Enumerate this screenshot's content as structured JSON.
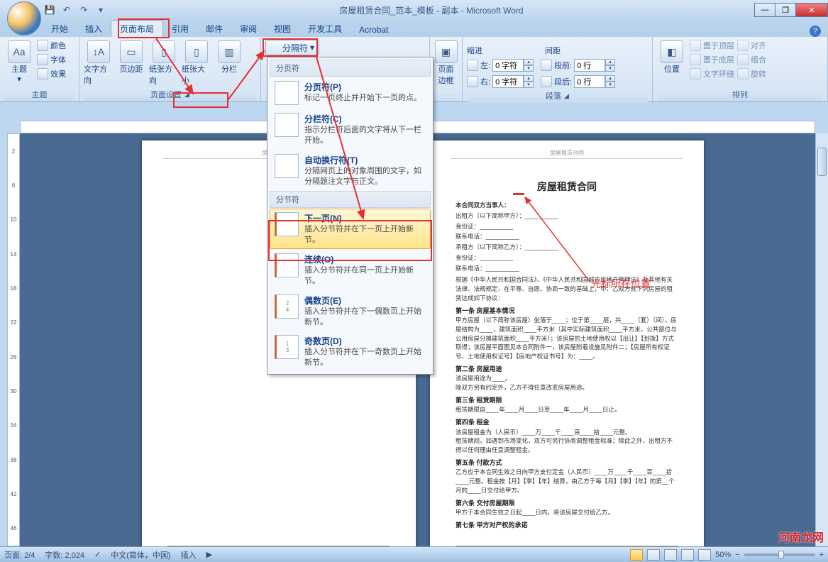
{
  "title": "房屋租赁合同_范本_模板 - 副本 - Microsoft Word",
  "tabs": [
    "开始",
    "插入",
    "页面布局",
    "引用",
    "邮件",
    "审阅",
    "视图",
    "开发工具",
    "Acrobat"
  ],
  "active_tab": "页面布局",
  "ribbon": {
    "theme": {
      "label": "主题",
      "colors": "颜色",
      "fonts": "字体",
      "effects": "效果",
      "main": "主题"
    },
    "page_setup": {
      "label": "页面设置",
      "text_dir": "文字方向",
      "margins": "页边距",
      "orient": "纸张方向",
      "size": "纸张大小",
      "columns": "分栏",
      "breaks": "分隔符"
    },
    "page_bg": {
      "label": "页面边框",
      "btn": "页面\n边框"
    },
    "indent": {
      "group": "缩进",
      "left": "左:",
      "right": "右:",
      "val": "0 字符"
    },
    "spacing": {
      "group": "间距",
      "before": "段前:",
      "after": "段后:",
      "val": "0 行"
    },
    "para": "段落",
    "arrange": {
      "label": "排列",
      "pos": "位置",
      "top": "置于顶层",
      "bottom": "置于底层",
      "wrap": "文字环绕",
      "align": "对齐",
      "group": "组合",
      "rotate": "旋转"
    }
  },
  "dropdown": {
    "section1": "分页符",
    "items1": [
      {
        "title": "分页符(P)",
        "desc": "标记一页终止并开始下一页的点。"
      },
      {
        "title": "分栏符(C)",
        "desc": "指示分栏符后面的文字将从下一栏开始。"
      },
      {
        "title": "自动换行符(T)",
        "desc": "分隔网页上的对象周围的文字，如分隔题注文字与正文。"
      }
    ],
    "section2": "分节符",
    "items2": [
      {
        "title": "下一页(N)",
        "desc": "插入分节符并在下一页上开始新节。"
      },
      {
        "title": "连续(O)",
        "desc": "插入分节符并在同一页上开始新节。"
      },
      {
        "title": "偶数页(E)",
        "desc": "插入分节符并在下一偶数页上开始新节。"
      },
      {
        "title": "奇数页(D)",
        "desc": "插入分节符并在下一奇数页上开始新节。"
      }
    ]
  },
  "document": {
    "header": "房屋租赁合同",
    "title": "房屋租赁合同",
    "parties": "本合同双方当事人：",
    "lessor": "出租方（以下简称甲方）：__________",
    "id1": "身份证：__________",
    "tel1": "联系电话：__________",
    "lessee": "承租方（以下简称乙方）：__________",
    "id2": "身份证：__________",
    "tel2": "联系电话：__________",
    "preamble": "根据《中华人民共和国合同法》、《中华人民共和国城市房地产管理法》及其他有关法律、法规规定，在平等、自愿、协商一致的基础上，甲、乙双方就下列房屋的租赁达成如下协议：",
    "s1": "第一条 房屋基本情况",
    "s1b": "甲方房屋（以下简称该房屋）坐落于____；位于第____层，共____（套）（间），房屋结构为____，建筑面积____平方米（其中实际建筑面积____平方米，公共部位与公用房屋分摊建筑面积____平方米）；该房屋的土地使用权以【出让】【划拨】方式取得；该房屋平面图见本合同附件一，该房屋附着设施见附件二；【房屋所有权证号、土地使用权证号】【房地产权证书号】为：____。",
    "s2": "第二条 房屋用途",
    "s2b": "该房屋用途为____。\n除双方另有约定外，乙方不得任意改变房屋用途。",
    "s3": "第三条 租赁期限",
    "s3b": "租赁期限自____年____月____日至____年____月____日止。",
    "s4": "第四条 租金",
    "s4b": "该房屋租金为（人民币）____万____千____百____拾____元整。\n租赁期间，如遇到市场变化，双方可另行协商调整租金标准；除此之外，出租方不得以任何理由任意调整租金。",
    "s5": "第五条 付款方式",
    "s5b": "乙方应于本合同生效之日向甲方支付定金（人民币）____万____千____百____拾____元整。租金按【月】【季】【年】结算，由乙方于每【月】【季】【年】的第__个月的____日交付给甲方。",
    "s6": "第六条 交付房屋期限",
    "s6b": "甲方于本合同生效之日起____日内，将该房屋交付给乙方。",
    "s7": "第七条 甲方对产权的承诺"
  },
  "annotation": "光标所在位置",
  "status": {
    "page": "页面: 2/4",
    "words": "字数: 2,024",
    "lang": "中文(简体，中国)",
    "mode": "插入",
    "zoom": "50%"
  },
  "watermark": "河南龙网"
}
